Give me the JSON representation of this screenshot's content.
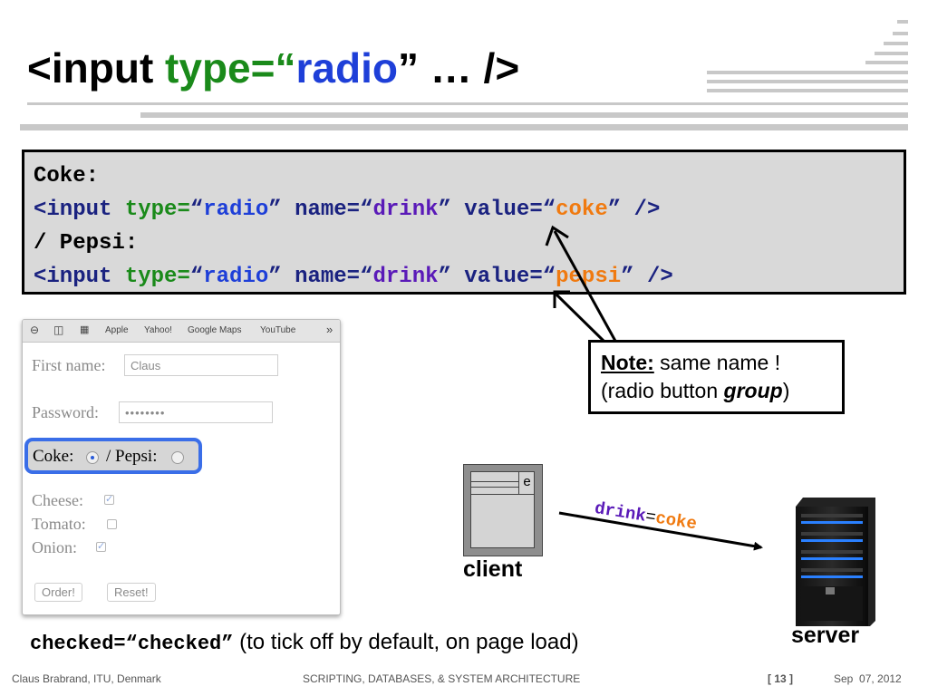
{
  "title": {
    "part1": "<input ",
    "part2": "type",
    "part3": "=“",
    "part4": "radio",
    "part5": "” … />"
  },
  "code": {
    "l1": "Coke:",
    "l2": {
      "a": "<input ",
      "b": "type=",
      "c": "“",
      "d": "radio",
      "e": "” name=“",
      "f": "drink",
      "g": "” value=“",
      "h": "coke",
      "i": "” />"
    },
    "l3": "/ Pepsi:",
    "l4": {
      "a": "<input ",
      "b": "type=",
      "c": "“",
      "d": "radio",
      "e": "” name=“",
      "f": "drink",
      "g": "” value=“",
      "h": "pepsi",
      "i": "” />"
    }
  },
  "browser": {
    "bookmarks": [
      "Apple",
      "Yahoo!",
      "Google Maps",
      "YouTube"
    ],
    "more": "»",
    "first_name_label": "First name:",
    "first_name_value": "Claus",
    "password_label": "Password:",
    "password_value": "••••••••",
    "coke_label": "Coke:",
    "pepsi_label": "/ Pepsi:",
    "cheese_label": "Cheese:",
    "tomato_label": "Tomato:",
    "onion_label": "Onion:",
    "checks": {
      "cheese": true,
      "tomato": false,
      "onion": true
    },
    "order_button": "Order!",
    "reset_button": "Reset!"
  },
  "note": {
    "bold": "Note:",
    "text1": " same name !",
    "text2": "(radio button ",
    "italic": "group",
    "text3": ")"
  },
  "client": {
    "label": "client",
    "e": "e"
  },
  "arrow_label": {
    "name": "drink",
    "eq": "=",
    "value": "coke"
  },
  "server": {
    "label": "server"
  },
  "checked_note": {
    "code": "checked=“checked”",
    "text": " (to tick off by default, on page load)"
  },
  "footer": {
    "author": "Claus Brabrand, ITU, Denmark",
    "course": "SCRIPTING, DATABASES, & SYSTEM ARCHITECTURE",
    "page": "[ 13 ]",
    "date": "Sep  07, 2012"
  },
  "colors": {
    "green": "#1a8a1a",
    "blue": "#1e3fd8",
    "purple": "#5a1ab8",
    "orange": "#f07a10",
    "highlight": "#3a6ee8"
  }
}
